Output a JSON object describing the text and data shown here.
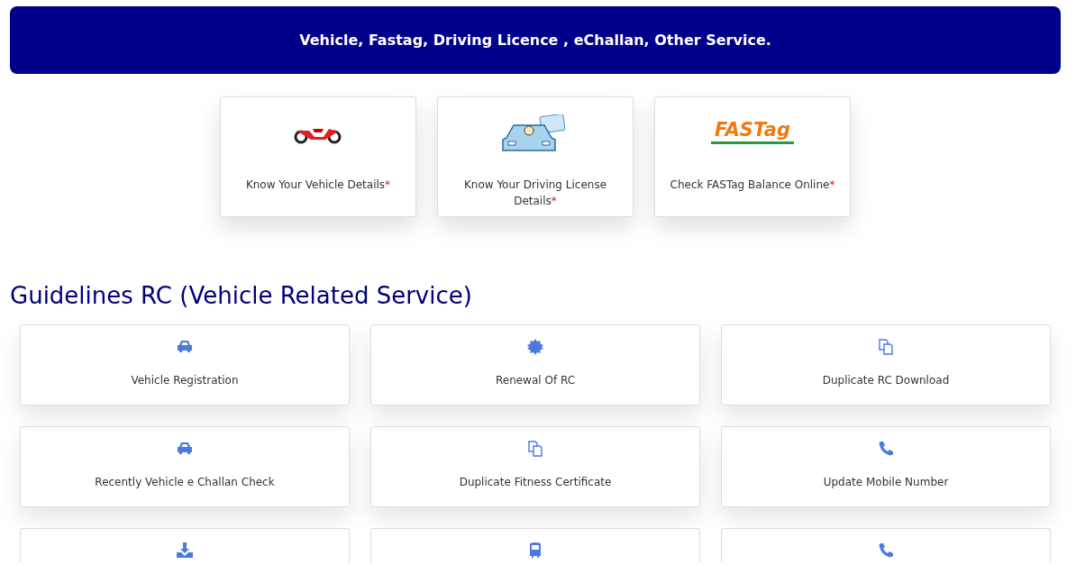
{
  "banner": {
    "title": "Vehicle, Fastag, Driving Licence , eChallan, Other Service."
  },
  "featured": [
    {
      "kind": "motorbike",
      "label": "Know Your Vehicle Details",
      "required": "*"
    },
    {
      "kind": "driver",
      "label": "Know Your Driving License Details",
      "required": "*"
    },
    {
      "kind": "fastag",
      "logo_text": "FASTag",
      "label": "Check FASTag Balance Online",
      "required": "*"
    }
  ],
  "section": {
    "heading": "Guidelines RC (Vehicle Related Service)"
  },
  "services": [
    {
      "kind": "car",
      "label": "Vehicle Registration"
    },
    {
      "kind": "badge",
      "label": "Renewal Of RC"
    },
    {
      "kind": "copy",
      "label": "Duplicate RC Download"
    },
    {
      "kind": "car",
      "label": "Recently Vehicle e Challan Check"
    },
    {
      "kind": "copy",
      "label": "Duplicate Fitness Certificate"
    },
    {
      "kind": "phone",
      "label": "Update Mobile Number"
    },
    {
      "kind": "download"
    },
    {
      "kind": "bus"
    },
    {
      "kind": "phone"
    }
  ]
}
